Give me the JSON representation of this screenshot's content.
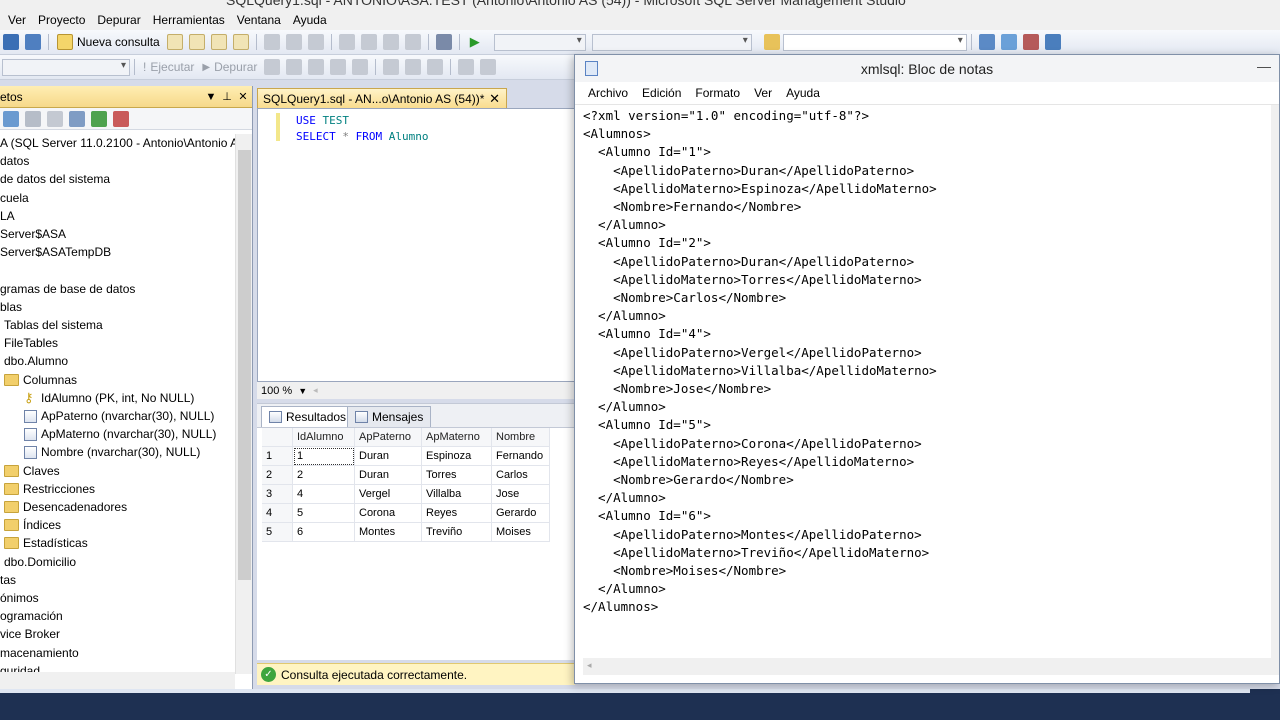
{
  "ssms": {
    "window_title": "SQLQuery1.sql - ANTONIO\\ASA.TEST (Antonio\\Antonio AS (54)) - Microsoft SQL Server Management Studio",
    "menu": [
      "Ver",
      "Proyecto",
      "Depurar",
      "Herramientas",
      "Ventana",
      "Ayuda"
    ],
    "toolbar": {
      "new_query": "Nueva consulta",
      "execute": "Ejecutar",
      "debug": "Depurar"
    },
    "object_explorer": {
      "title": "etos",
      "items": [
        {
          "label": "A (SQL Server 11.0.2100 - Antonio\\Antonio A",
          "icon": "server-icon"
        },
        {
          "label": "datos",
          "icon": ""
        },
        {
          "label": "de datos del sistema",
          "icon": ""
        },
        {
          "label": "cuela",
          "icon": ""
        },
        {
          "label": "LA",
          "icon": ""
        },
        {
          "label": "Server$ASA",
          "icon": ""
        },
        {
          "label": "Server$ASATempDB",
          "icon": ""
        },
        {
          "label": "",
          "icon": ""
        },
        {
          "label": "gramas de base de datos",
          "icon": ""
        },
        {
          "label": "blas",
          "icon": ""
        },
        {
          "label": "Tablas del sistema",
          "icon": ""
        },
        {
          "label": "FileTables",
          "icon": ""
        },
        {
          "label": "dbo.Alumno",
          "icon": ""
        },
        {
          "label": "Columnas",
          "icon": "folder-icon"
        },
        {
          "label": "IdAlumno (PK, int, No NULL)",
          "icon": "key-icon"
        },
        {
          "label": "ApPaterno (nvarchar(30), NULL)",
          "icon": "column-icon"
        },
        {
          "label": "ApMaterno (nvarchar(30), NULL)",
          "icon": "column-icon"
        },
        {
          "label": "Nombre (nvarchar(30), NULL)",
          "icon": "column-icon"
        },
        {
          "label": "Claves",
          "icon": "folder-icon"
        },
        {
          "label": "Restricciones",
          "icon": "folder-icon"
        },
        {
          "label": "Desencadenadores",
          "icon": "folder-icon"
        },
        {
          "label": "Índices",
          "icon": "folder-icon"
        },
        {
          "label": "Estadísticas",
          "icon": "folder-icon"
        },
        {
          "label": "dbo.Domicilio",
          "icon": ""
        },
        {
          "label": "tas",
          "icon": ""
        },
        {
          "label": "ónimos",
          "icon": ""
        },
        {
          "label": "ogramación",
          "icon": ""
        },
        {
          "label": "vice Broker",
          "icon": ""
        },
        {
          "label": "macenamiento",
          "icon": ""
        },
        {
          "label": "guridad",
          "icon": ""
        }
      ]
    },
    "query_tab": "SQLQuery1.sql - AN...o\\Antonio AS (54))*",
    "editor": {
      "line1_kw": "USE",
      "line1_rest": " TEST",
      "line2_kw1": "SELECT",
      "line2_star": " * ",
      "line2_kw2": "FROM",
      "line2_table": " Alumno"
    },
    "zoom": "100 %",
    "result_tabs": {
      "results": "Resultados",
      "messages": "Mensajes"
    },
    "grid": {
      "columns": [
        "IdAlumno",
        "ApPaterno",
        "ApMaterno",
        "Nombre"
      ],
      "rows": [
        {
          "n": "1",
          "cells": [
            "1",
            "Duran",
            "Espinoza",
            "Fernando"
          ]
        },
        {
          "n": "2",
          "cells": [
            "2",
            "Duran",
            "Torres",
            "Carlos"
          ]
        },
        {
          "n": "3",
          "cells": [
            "4",
            "Vergel",
            "Villalba",
            "Jose"
          ]
        },
        {
          "n": "4",
          "cells": [
            "5",
            "Corona",
            "Reyes",
            "Gerardo"
          ]
        },
        {
          "n": "5",
          "cells": [
            "6",
            "Montes",
            "Treviño",
            "Moises"
          ]
        }
      ]
    },
    "status": "Consulta ejecutada correctamente."
  },
  "notepad": {
    "title": "xmlsql: Bloc de notas",
    "menu": [
      "Archivo",
      "Edición",
      "Formato",
      "Ver",
      "Ayuda"
    ],
    "lines": [
      "<?xml version=\"1.0\" encoding=\"utf-8\"?>",
      "<Alumnos>",
      "  <Alumno Id=\"1\">",
      "    <ApellidoPaterno>Duran</ApellidoPaterno>",
      "    <ApellidoMaterno>Espinoza</ApellidoMaterno>",
      "    <Nombre>Fernando</Nombre>",
      "  </Alumno>",
      "  <Alumno Id=\"2\">",
      "    <ApellidoPaterno>Duran</ApellidoPaterno>",
      "    <ApellidoMaterno>Torres</ApellidoMaterno>",
      "    <Nombre>Carlos</Nombre>",
      "  </Alumno>",
      "  <Alumno Id=\"4\">",
      "    <ApellidoPaterno>Vergel</ApellidoPaterno>",
      "    <ApellidoMaterno>Villalba</ApellidoMaterno>",
      "    <Nombre>Jose</Nombre>",
      "  </Alumno>",
      "  <Alumno Id=\"5\">",
      "    <ApellidoPaterno>Corona</ApellidoPaterno>",
      "    <ApellidoMaterno>Reyes</ApellidoMaterno>",
      "    <Nombre>Gerardo</Nombre>",
      "  </Alumno>",
      "  <Alumno Id=\"6\">",
      "    <ApellidoPaterno>Montes</ApellidoPaterno>",
      "    <ApellidoMaterno>Treviño</ApellidoMaterno>",
      "    <Nombre>Moises</Nombre>",
      "  </Alumno>",
      "</Alumnos>"
    ]
  },
  "colors": {
    "accent_header": "#f6d98a",
    "status_ok": "#3ea53e",
    "keyword": "#0000ff"
  }
}
